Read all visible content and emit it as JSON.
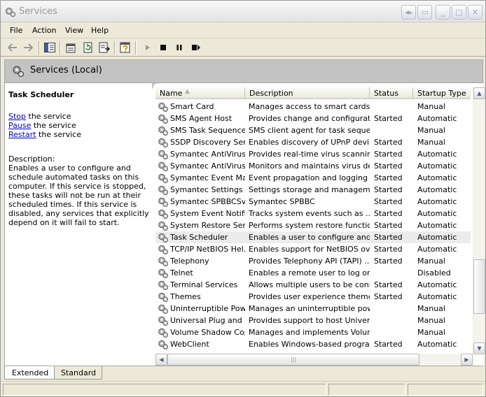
{
  "window": {
    "title": "Services"
  },
  "menu": {
    "items": [
      "File",
      "Action",
      "View",
      "Help"
    ]
  },
  "header": {
    "title": "Services (Local)"
  },
  "detail": {
    "service_name": "Task Scheduler",
    "actions": [
      {
        "link": "Stop",
        "rest": " the service"
      },
      {
        "link": "Pause",
        "rest": " the service"
      },
      {
        "link": "Restart",
        "rest": " the service"
      }
    ],
    "description_label": "Description:",
    "description": "Enables a user to configure and schedule automated tasks on this computer. If this service is stopped, these tasks will not be run at their scheduled times. If this service is disabled, any services that explicitly depend on it will fail to start."
  },
  "table": {
    "columns": [
      "Name",
      "Description",
      "Status",
      "Startup Type"
    ],
    "rows": [
      {
        "name": "Smart Card",
        "description": "Manages access to smart cards ...",
        "status": "",
        "startup": "Manual"
      },
      {
        "name": "SMS Agent Host",
        "description": "Provides change and configurati...",
        "status": "Started",
        "startup": "Automatic"
      },
      {
        "name": "SMS Task Sequence...",
        "description": "SMS client agent for task seque...",
        "status": "",
        "startup": "Manual"
      },
      {
        "name": "SSDP Discovery Ser...",
        "description": "Enables discovery of UPnP devi...",
        "status": "Started",
        "startup": "Manual"
      },
      {
        "name": "Symantec AntiVirus",
        "description": "Provides real-time virus scannin...",
        "status": "Started",
        "startup": "Automatic"
      },
      {
        "name": "Symantec AntiVirus ...",
        "description": "Monitors and maintains virus de...",
        "status": "Started",
        "startup": "Automatic"
      },
      {
        "name": "Symantec Event Ma...",
        "description": "Event propagation and logging ...",
        "status": "Started",
        "startup": "Automatic"
      },
      {
        "name": "Symantec Settings ...",
        "description": "Settings storage and managem...",
        "status": "Started",
        "startup": "Automatic"
      },
      {
        "name": "Symantec SPBBCSvc",
        "description": "Symantec SPBBC",
        "status": "Started",
        "startup": "Automatic"
      },
      {
        "name": "System Event Notifi...",
        "description": "Tracks system events such as ...",
        "status": "Started",
        "startup": "Automatic"
      },
      {
        "name": "System Restore Ser...",
        "description": "Performs system restore functio...",
        "status": "Started",
        "startup": "Automatic"
      },
      {
        "name": "Task Scheduler",
        "description": "Enables a user to configure and...",
        "status": "Started",
        "startup": "Automatic",
        "selected": true
      },
      {
        "name": "TCP/IP NetBIOS Hel...",
        "description": "Enables support for NetBIOS ov...",
        "status": "Started",
        "startup": "Automatic"
      },
      {
        "name": "Telephony",
        "description": "Provides Telephony API (TAPI) ...",
        "status": "Started",
        "startup": "Manual"
      },
      {
        "name": "Telnet",
        "description": "Enables a remote user to log on...",
        "status": "",
        "startup": "Disabled"
      },
      {
        "name": "Terminal Services",
        "description": "Allows multiple users to be conn...",
        "status": "Started",
        "startup": "Automatic"
      },
      {
        "name": "Themes",
        "description": "Provides user experience theme...",
        "status": "Started",
        "startup": "Automatic"
      },
      {
        "name": "Uninterruptible Pow...",
        "description": "Manages an uninterruptible pow...",
        "status": "",
        "startup": "Manual"
      },
      {
        "name": "Universal Plug and ...",
        "description": "Provides support to host Univer...",
        "status": "",
        "startup": "Manual"
      },
      {
        "name": "Volume Shadow Copy",
        "description": "Manages and implements Volum...",
        "status": "",
        "startup": "Manual"
      },
      {
        "name": "WebClient",
        "description": "Enables Windows-based progra...",
        "status": "Started",
        "startup": "Automatic"
      }
    ]
  },
  "tabs": [
    {
      "label": "Extended",
      "active": true
    },
    {
      "label": "Standard",
      "active": false
    }
  ]
}
